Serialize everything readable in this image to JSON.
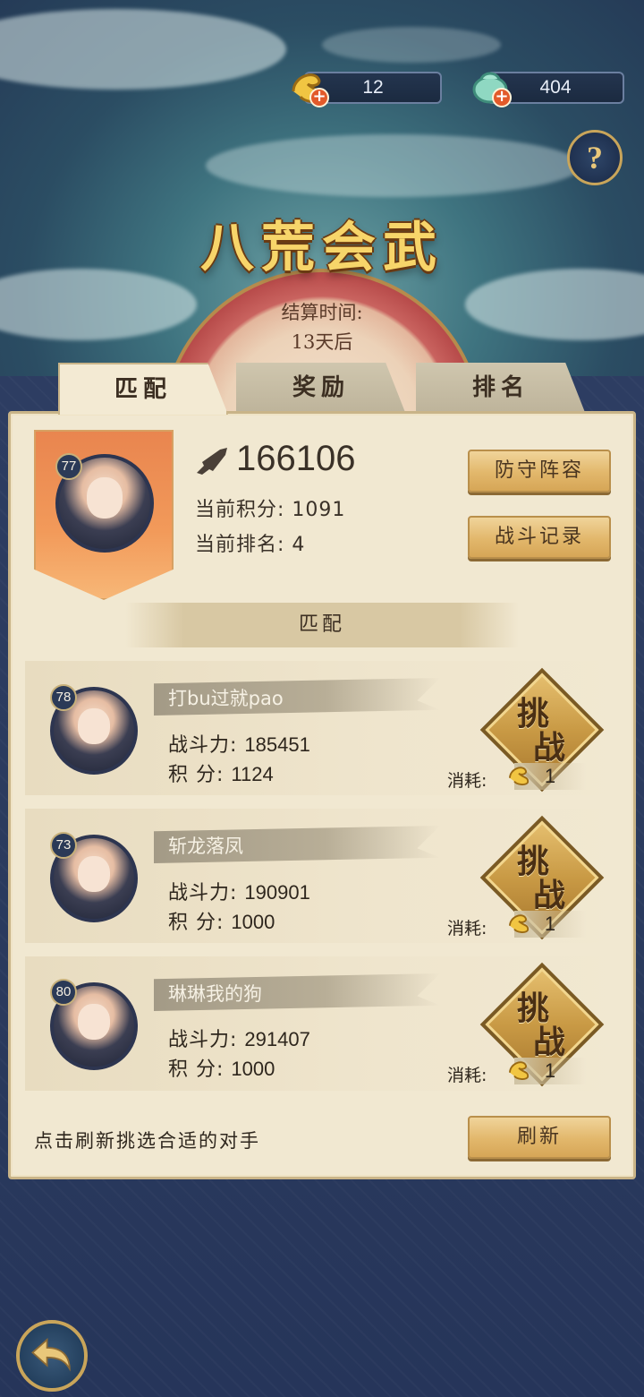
{
  "resources": {
    "coin": {
      "value": "12",
      "icon": "dragon-coin-icon"
    },
    "gem": {
      "value": "404",
      "icon": "jade-pouch-icon"
    }
  },
  "help_label": "?",
  "title": "八荒会武",
  "settlement": {
    "label": "结算时间:",
    "value": "13天后"
  },
  "tabs": [
    {
      "label": "匹配",
      "active": true
    },
    {
      "label": "奖励",
      "active": false
    },
    {
      "label": "排名",
      "active": false
    }
  ],
  "player": {
    "level": "77",
    "power": "166106",
    "score_line": "当前积分: 1091",
    "rank_line": "当前排名: 4"
  },
  "buttons": {
    "defense": "防守阵容",
    "battle_log": "战斗记录",
    "refresh": "刷新"
  },
  "match_header": "匹配",
  "opponents": [
    {
      "level": "78",
      "name": "打bu过就pao",
      "power_label": "战斗力:",
      "power": "185451",
      "score_label": "积 分:",
      "score": "1124",
      "cost_label": "消耗:",
      "cost": "1"
    },
    {
      "level": "73",
      "name": "斩龙落凤",
      "power_label": "战斗力:",
      "power": "190901",
      "score_label": "积 分:",
      "score": "1000",
      "cost_label": "消耗:",
      "cost": "1"
    },
    {
      "level": "80",
      "name": "琳琳我的狗",
      "power_label": "战斗力:",
      "power": "291407",
      "score_label": "积 分:",
      "score": "1000",
      "cost_label": "消耗:",
      "cost": "1"
    }
  ],
  "challenge_label_top": "挑",
  "challenge_label_bottom": "战",
  "hint": "点击刷新挑选合适的对手",
  "colors": {
    "gold": "#f7d56a",
    "panel": "#f1e8d1",
    "accent_red": "#e25a2a",
    "night_blue": "#2c3b5e"
  }
}
